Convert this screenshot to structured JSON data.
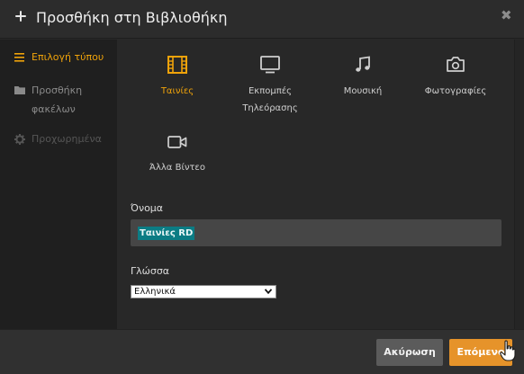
{
  "dialog": {
    "title": "Προσθήκη στη Βιβλιοθήκη",
    "close_glyph": "✖"
  },
  "sidebar": {
    "items": [
      {
        "label": "Επιλογή τύπου",
        "icon": "list-icon",
        "state": "active"
      },
      {
        "label": "Προσθήκη φακέλων",
        "icon": "folder-icon",
        "state": "normal"
      },
      {
        "label": "Προχωρημένα",
        "icon": "gear-icon",
        "state": "disabled"
      }
    ]
  },
  "media_types": [
    {
      "label": "Ταινίες",
      "icon": "film-icon",
      "selected": true
    },
    {
      "label": "Εκπομπές Τηλεόρασης",
      "icon": "tv-icon",
      "selected": false
    },
    {
      "label": "Μουσική",
      "icon": "music-note-icon",
      "selected": false
    },
    {
      "label": "Φωτογραφίες",
      "icon": "camera-icon",
      "selected": false
    },
    {
      "label": "Άλλα Βίντεο",
      "icon": "video-camera-icon",
      "selected": false
    }
  ],
  "form": {
    "name_label": "Όνομα",
    "name_value": "Ταινίες RD",
    "language_label": "Γλώσσα",
    "language_value": "Ελληνικά"
  },
  "footer": {
    "cancel_label": "Ακύρωση",
    "next_label": "Επόμενο"
  },
  "colors": {
    "accent": "#f0a30a",
    "next_button": "#e6932a",
    "cancel_button": "#5b5b5b",
    "selection_highlight": "#0b7c84",
    "sidebar_bg": "#1f1f1f",
    "dialog_bg": "#282828"
  }
}
